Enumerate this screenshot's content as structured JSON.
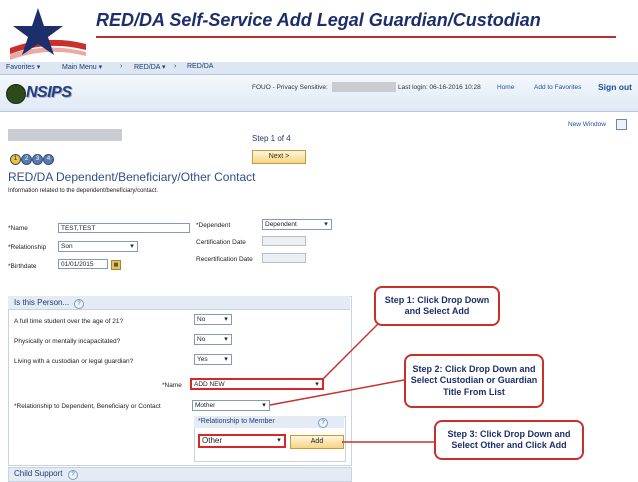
{
  "slide": {
    "title": "RED/DA Self-Service Add Legal Guardian/Custodian"
  },
  "nav": {
    "favorites": "Favorites ▾",
    "main_menu": "Main Menu ▾",
    "sep1": "›",
    "redda_menu": "RED/DA ▾",
    "sep2": "›",
    "redda": "RED/DA"
  },
  "header": {
    "logo_text": "NSIPS",
    "fouo": "FOUO - Privacy Sensitive:",
    "last_login": "Last login: 06-16-2016 10:28",
    "home": "Home",
    "add_favorites": "Add to Favorites",
    "sign_out": "Sign out"
  },
  "page": {
    "step": "Step 1 of 4",
    "next_label": "Next >",
    "new_window": "New Window",
    "steps": [
      "1",
      "2",
      "3",
      "4"
    ],
    "heading": "RED/DA Dependent/Beneficiary/Other Contact",
    "subheading": "Information related to the dependent/beneficiary/contact."
  },
  "form": {
    "name_label": "*Name",
    "name_value": "TEST,TEST",
    "relationship_label": "*Relationship",
    "relationship_value": "Son",
    "birthdate_label": "*Birthdate",
    "birthdate_value": "01/01/2015",
    "dependent_label": "*Dependent",
    "dependent_value": "Dependent",
    "cert_label": "Certification Date",
    "recert_label": "Recertification Date"
  },
  "is_this_person": {
    "title": "Is this Person...",
    "q1": "A full time student over the age of 21?",
    "a1": "No",
    "q2": "Physically or mentally incapacitated?",
    "a2": "No",
    "q3": "Living with a custodian or legal guardian?",
    "a3": "Yes",
    "name_label": "*Name",
    "name_value": "ADD NEW",
    "rel_label": "*Relationship to Dependent, Beneficiary or Contact",
    "rel_value": "Mother",
    "rtm_title": "*Relationship to Member",
    "rtm_value": "Other",
    "add_label": "Add"
  },
  "child_support": {
    "title": "Child Support"
  },
  "callouts": {
    "c1": "Step 1:  Click Drop Down and Select Add",
    "c2": "Step 2:  Click Drop Down and Select Custodian or Guardian Title From List",
    "c3": "Step 3: Click Drop Down and Select Other and Click Add"
  },
  "colors": {
    "callout_border": "#c9302c",
    "title_navy": "#1d2f6b",
    "rule_red": "#b5322f"
  }
}
